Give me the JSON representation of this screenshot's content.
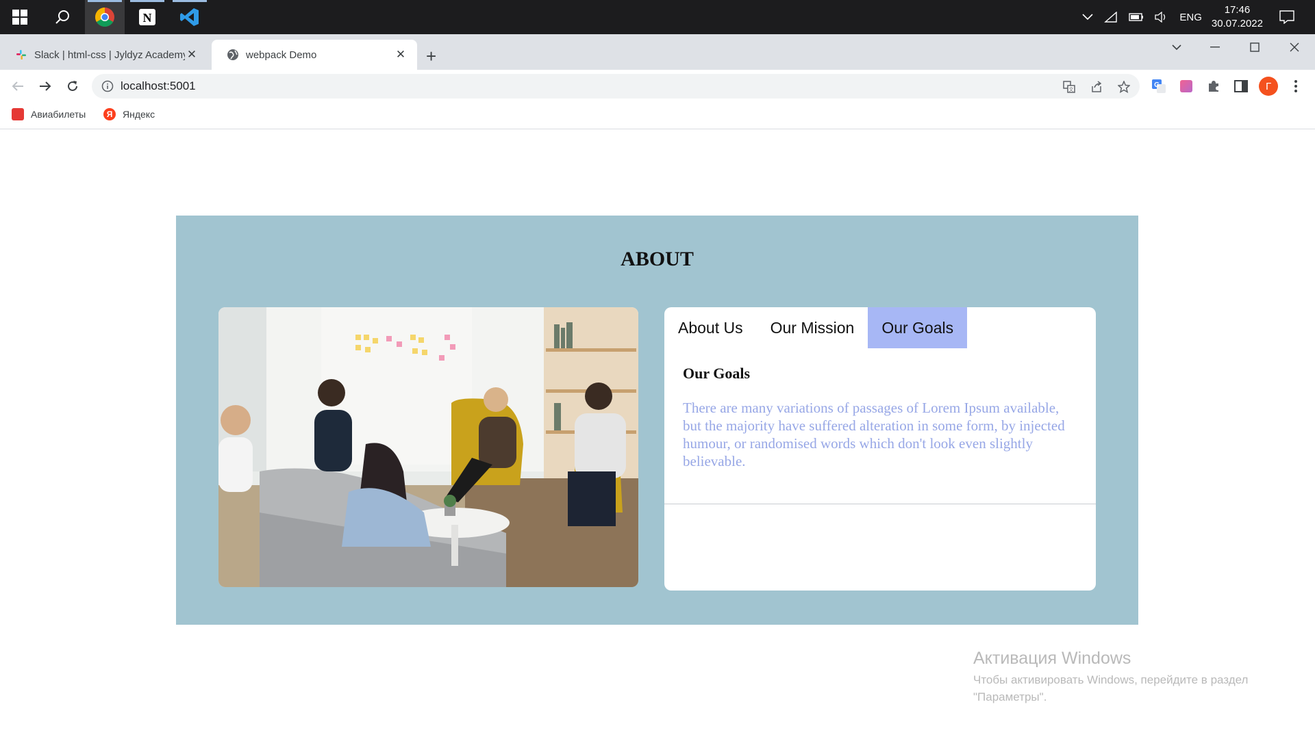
{
  "taskbar": {
    "apps": [
      "windows-start",
      "search",
      "chrome",
      "notion",
      "vscode"
    ],
    "tray": {
      "language": "ENG",
      "time": "17:46",
      "date": "30.07.2022"
    }
  },
  "browser": {
    "tabs": [
      {
        "title": "Slack | html-css | Jyldyz Academy",
        "icon": "slack-icon",
        "active": false
      },
      {
        "title": "webpack Demo",
        "icon": "globe-icon",
        "active": true
      }
    ],
    "url": "localhost:5001",
    "profile_initial": "Г",
    "bookmarks": [
      {
        "label": "Авиабилеты",
        "icon": "aviatickets-icon"
      },
      {
        "label": "Яндекс",
        "icon": "yandex-icon"
      }
    ]
  },
  "page": {
    "section_title": "ABOUT",
    "tabs": [
      {
        "label": "About Us",
        "active": false
      },
      {
        "label": "Our Mission",
        "active": false
      },
      {
        "label": "Our Goals",
        "active": true
      }
    ],
    "panel": {
      "heading": "Our Goals",
      "text": "There are many variations of passages of Lorem Ipsum available, but the majority have suffered alteration in some form, by injected humour, or randomised words which don't look even slightly believable."
    },
    "colors": {
      "section_bg": "#a1c4d0",
      "active_tab_bg": "#a7b7f5",
      "panel_text": "#97a7e6"
    }
  },
  "watermark": {
    "title": "Активация Windows",
    "subtitle": "Чтобы активировать Windows, перейдите в раздел \"Параметры\"."
  }
}
